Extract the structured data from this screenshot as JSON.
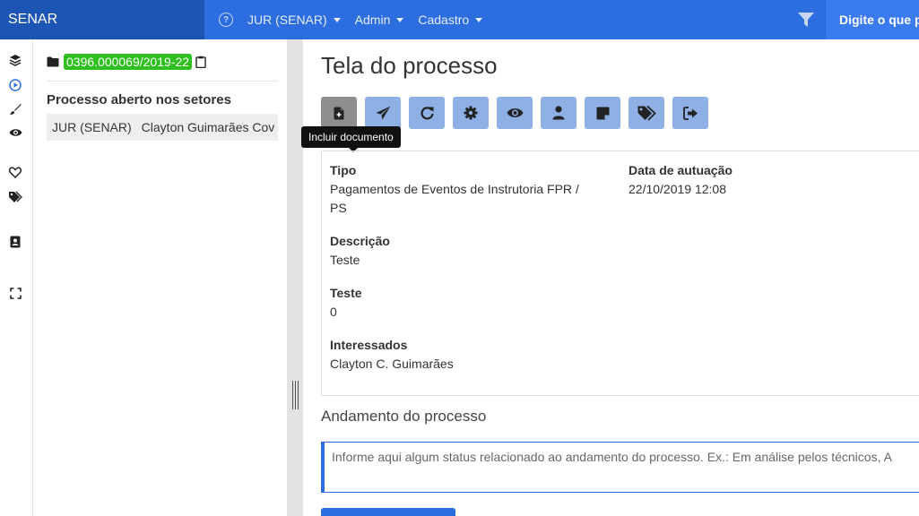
{
  "navbar": {
    "brand": "SENAR",
    "menu": [
      {
        "label": "JUR (SENAR)"
      },
      {
        "label": "Admin"
      },
      {
        "label": "Cadastro"
      }
    ],
    "search_text": "Digite o que p",
    "help_icon": "question-circle-icon",
    "filter_icon": "filter-icon"
  },
  "rail": {
    "icons": [
      "layers-icon",
      "play-circle-icon",
      "brush-icon",
      "eye-icon",
      "heart-icon",
      "tags-icon",
      "contact-card-icon",
      "expand-icon"
    ]
  },
  "sidebar": {
    "process_number": "0396.000069/2019-22",
    "section_title": "Processo aberto nos setores",
    "sector_row": {
      "sector": "JUR (SENAR)",
      "person": "Clayton Guimarães Cov"
    }
  },
  "main": {
    "title": "Tela do processo",
    "tooltip": "Incluir documento",
    "toolbar": [
      "add-document-icon",
      "send-icon",
      "refresh-icon",
      "gear-icon",
      "eye-icon",
      "user-icon",
      "note-icon",
      "tags-icon",
      "sign-out-icon"
    ],
    "details": {
      "tipo_label": "Tipo",
      "tipo_value_1": "Pagamentos de Eventos de Instrutoria FPR /",
      "tipo_value_2": "PS",
      "data_label": "Data de autuação",
      "data_value": "22/10/2019 12:08",
      "descricao_label": "Descrição",
      "descricao_value": "Teste",
      "teste_label": "Teste",
      "teste_value": "0",
      "interessados_label": "Interessados",
      "interessados_value": "Clayton C. Guimarães"
    },
    "andamento_title": "Andamento do processo",
    "andamento_placeholder": "Informe aqui algum status relacionado ao andamento do processo. Ex.: Em análise pelos técnicos, A"
  },
  "colors": {
    "primary": "#2c6de0",
    "brand_bg": "#1d55b5",
    "toolbar_button": "#8fb0e4",
    "process_badge": "#2fbf1f"
  }
}
